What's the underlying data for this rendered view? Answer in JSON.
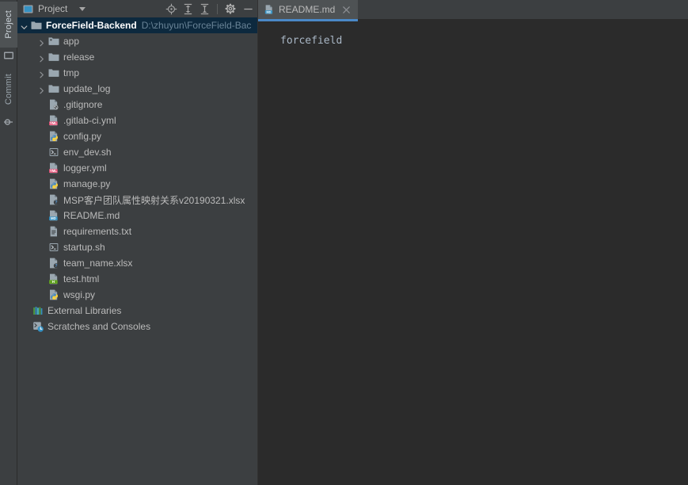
{
  "stripe": {
    "project_tab": "Project",
    "commit_tab": "Commit"
  },
  "project_panel": {
    "title": "Project",
    "toolbar": {
      "locate_label": "Select Opened File",
      "expand_label": "Expand All",
      "collapse_label": "Collapse All",
      "settings_label": "Settings",
      "hide_label": "Hide"
    },
    "tree": [
      {
        "label": "ForceField-Backend",
        "path": "D:\\zhuyun\\ForceField-Bac",
        "icon": "folder-module-icon",
        "level": 0,
        "expanded": true,
        "selected": true,
        "bold": true
      },
      {
        "label": "app",
        "path": "",
        "icon": "folder-source-icon",
        "level": 1,
        "expanded": false,
        "selected": false,
        "bold": false
      },
      {
        "label": "release",
        "path": "",
        "icon": "folder-icon",
        "level": 1,
        "expanded": false,
        "selected": false,
        "bold": false
      },
      {
        "label": "tmp",
        "path": "",
        "icon": "folder-icon",
        "level": 1,
        "expanded": false,
        "selected": false,
        "bold": false
      },
      {
        "label": "update_log",
        "path": "",
        "icon": "folder-icon",
        "level": 1,
        "expanded": false,
        "selected": false,
        "bold": false
      },
      {
        "label": ".gitignore",
        "path": "",
        "icon": "gitignore-file-icon",
        "level": 2,
        "expanded": null,
        "selected": false,
        "bold": false
      },
      {
        "label": ".gitlab-ci.yml",
        "path": "",
        "icon": "yml-file-icon",
        "level": 2,
        "expanded": null,
        "selected": false,
        "bold": false
      },
      {
        "label": "config.py",
        "path": "",
        "icon": "python-file-icon",
        "level": 2,
        "expanded": null,
        "selected": false,
        "bold": false
      },
      {
        "label": "env_dev.sh",
        "path": "",
        "icon": "shell-file-icon",
        "level": 2,
        "expanded": null,
        "selected": false,
        "bold": false
      },
      {
        "label": "logger.yml",
        "path": "",
        "icon": "yml-file-icon",
        "level": 2,
        "expanded": null,
        "selected": false,
        "bold": false
      },
      {
        "label": "manage.py",
        "path": "",
        "icon": "python-file-icon",
        "level": 2,
        "expanded": null,
        "selected": false,
        "bold": false
      },
      {
        "label": "MSP客户团队属性映射关系v20190321.xlsx",
        "path": "",
        "icon": "unknown-file-icon",
        "level": 2,
        "expanded": null,
        "selected": false,
        "bold": false
      },
      {
        "label": "README.md",
        "path": "",
        "icon": "markdown-file-icon",
        "level": 2,
        "expanded": null,
        "selected": false,
        "bold": false
      },
      {
        "label": "requirements.txt",
        "path": "",
        "icon": "text-file-icon",
        "level": 2,
        "expanded": null,
        "selected": false,
        "bold": false
      },
      {
        "label": "startup.sh",
        "path": "",
        "icon": "shell-file-icon",
        "level": 2,
        "expanded": null,
        "selected": false,
        "bold": false
      },
      {
        "label": "team_name.xlsx",
        "path": "",
        "icon": "unknown-file-icon",
        "level": 2,
        "expanded": null,
        "selected": false,
        "bold": false
      },
      {
        "label": "test.html",
        "path": "",
        "icon": "html-file-icon",
        "level": 2,
        "expanded": null,
        "selected": false,
        "bold": false
      },
      {
        "label": "wsgi.py",
        "path": "",
        "icon": "python-file-icon",
        "level": 2,
        "expanded": null,
        "selected": false,
        "bold": false
      },
      {
        "label": "External Libraries",
        "path": "",
        "icon": "libraries-icon",
        "level": 0,
        "expanded": null,
        "selected": false,
        "bold": false
      },
      {
        "label": "Scratches and Consoles",
        "path": "",
        "icon": "scratches-icon",
        "level": 0,
        "expanded": null,
        "selected": false,
        "bold": false
      }
    ]
  },
  "editor": {
    "tabs": [
      {
        "label": "README.md",
        "icon": "markdown-file-icon",
        "active": true
      }
    ],
    "content": "forcefield"
  },
  "colors": {
    "panel_bg": "#3c3f41",
    "editor_bg": "#2b2b2b",
    "selection_bg": "#0d293e",
    "accent": "#4a88c7",
    "text": "#bbbbbb",
    "path_text": "#6a8497"
  }
}
